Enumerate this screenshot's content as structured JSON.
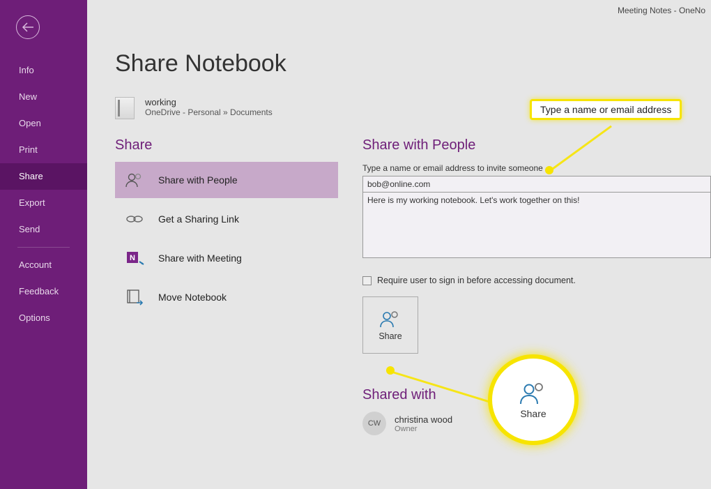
{
  "titleBar": "Meeting Notes  -  OneNo",
  "sidebar": {
    "items": [
      {
        "label": "Info"
      },
      {
        "label": "New"
      },
      {
        "label": "Open"
      },
      {
        "label": "Print"
      },
      {
        "label": "Share"
      },
      {
        "label": "Export"
      },
      {
        "label": "Send"
      }
    ],
    "footer": [
      {
        "label": "Account"
      },
      {
        "label": "Feedback"
      },
      {
        "label": "Options"
      }
    ],
    "selected": "Share"
  },
  "main": {
    "pageTitle": "Share Notebook",
    "notebook": {
      "name": "working",
      "path": "OneDrive - Personal » Documents"
    },
    "leftTitle": "Share",
    "options": [
      {
        "label": "Share with People"
      },
      {
        "label": "Get a Sharing Link"
      },
      {
        "label": "Share with Meeting"
      },
      {
        "label": "Move Notebook"
      }
    ],
    "rightTitle": "Share with People",
    "inviteHint": "Type a name or email address to invite someone",
    "emailValue": "bob@online.com",
    "messageValue": "Here is my working notebook. Let's work together on this!",
    "requireSignIn": "Require user to sign in before accessing document.",
    "shareButton": "Share",
    "sharedWithTitle": "Shared with",
    "sharedUser": {
      "initials": "CW",
      "name": "christina wood",
      "role": "Owner"
    }
  },
  "callouts": {
    "emailHint": "Type a name or email address",
    "shareCircle": "Share"
  }
}
